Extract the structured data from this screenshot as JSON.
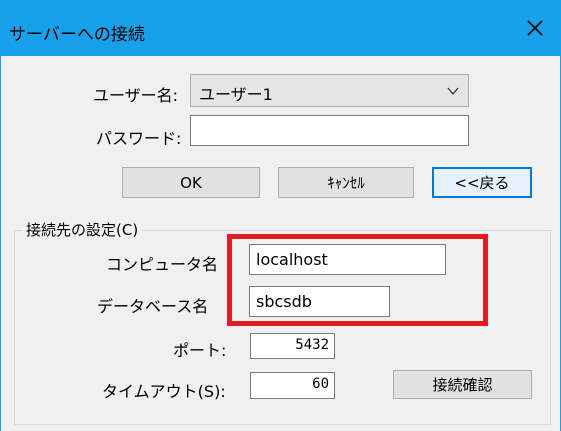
{
  "window": {
    "title": "サーバーへの接続",
    "close_icon": "close-icon"
  },
  "login": {
    "username_label": "ユーザー名:",
    "username_value": "ユーザー1",
    "password_label": "パスワード:",
    "password_value": ""
  },
  "buttons": {
    "ok": "OK",
    "cancel": "ｷｬﾝｾﾙ",
    "back": "<<戻る"
  },
  "connection": {
    "group_title": "接続先の設定(C)",
    "computer_label": "コンピュータ名",
    "computer_value": "localhost",
    "database_label": "データベース名",
    "database_value": "sbcsdb",
    "port_label": "ポート:",
    "port_value": "5432",
    "timeout_label": "タイムアウト(S):",
    "timeout_value": "60",
    "test_button": "接続確認"
  },
  "colors": {
    "titlebar": "#19a0eb",
    "highlight": "#e31b23",
    "dialog_bg": "#f0f0f0"
  }
}
